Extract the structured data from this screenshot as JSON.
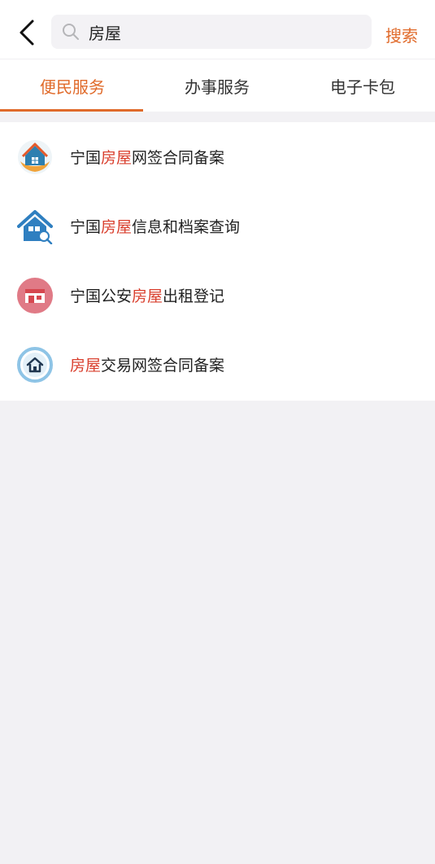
{
  "header": {
    "back_icon": "chevron-left-icon",
    "search": {
      "icon": "search-icon",
      "value": "房屋"
    },
    "search_button_label": "搜索"
  },
  "tabs": [
    {
      "label": "便民服务",
      "active": true
    },
    {
      "label": "办事服务",
      "active": false
    },
    {
      "label": "电子卡包",
      "active": false
    }
  ],
  "results": [
    {
      "pre": "宁国",
      "match": "房屋",
      "post": "网签合同备案",
      "icon": "house-in-hands-icon"
    },
    {
      "pre": "宁国",
      "match": "房屋",
      "post": "信息和档案查询",
      "icon": "house-search-icon"
    },
    {
      "pre": "宁国公安",
      "match": "房屋",
      "post": "出租登记",
      "icon": "storefront-icon"
    },
    {
      "pre": "",
      "match": "房屋",
      "post": "交易网签合同备案",
      "icon": "home-circle-icon"
    }
  ],
  "colors": {
    "accent": "#e06a2a",
    "highlight": "#d9402f",
    "background": "#f2f1f4"
  }
}
